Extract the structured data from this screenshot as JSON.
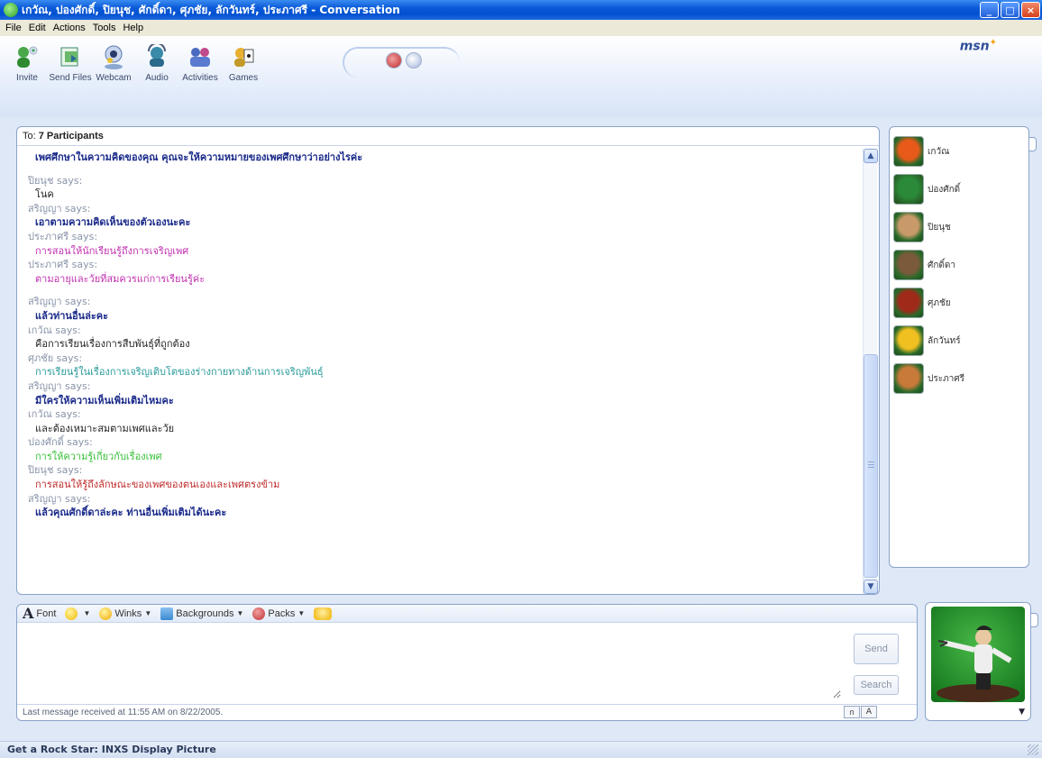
{
  "window": {
    "title": "เกวัณ, ปองศักดิ์, ปิยนุช, ศักดิ์ดา, ศุภชัย, ลักวันทร์, ประภาศรี - Conversation",
    "minimize": "_",
    "maximize": "□",
    "close": "×"
  },
  "menu": [
    "File",
    "Edit",
    "Actions",
    "Tools",
    "Help"
  ],
  "toolbar": {
    "items": [
      {
        "label": "Invite",
        "icon": "invite-icon",
        "color": "#3a9a3a"
      },
      {
        "label": "Send Files",
        "icon": "send-files-icon",
        "color": "#3a8a6a"
      },
      {
        "label": "Webcam",
        "icon": "webcam-icon",
        "color": "#5a78b0"
      },
      {
        "label": "Audio",
        "icon": "audio-icon",
        "color": "#3a7a9a"
      },
      {
        "label": "Activities",
        "icon": "activities-icon",
        "color": "#4a6ac0"
      },
      {
        "label": "Games",
        "icon": "games-icon",
        "color": "#c49a28"
      }
    ],
    "msn_logo": "msn",
    "msn_butterfly": "✦"
  },
  "chat": {
    "to_label": "To:",
    "to_value": "7 Participants",
    "lines": [
      {
        "kind": "msg",
        "text": "เพศศึกษาในความคิดของคุณ  คุณจะให้ความหมายของเพศศึกษาว่าอย่างไรค่ะ",
        "color": "#1a2a8a",
        "bold": true
      },
      {
        "kind": "spacer",
        "text": ""
      },
      {
        "kind": "says",
        "text": "ปิยนุช says:"
      },
      {
        "kind": "msg",
        "text": "โนค",
        "color": "#222222",
        "bold": false
      },
      {
        "kind": "says",
        "text": "สริญญา says:"
      },
      {
        "kind": "msg",
        "text": "เอาตามความคิดเห็นของตัวเองนะคะ",
        "color": "#1a2a8a",
        "bold": true
      },
      {
        "kind": "says",
        "text": "ประภาศรี says:"
      },
      {
        "kind": "msg",
        "text": "การสอนให้นักเรียนรู้ถึงการเจริญเพศ",
        "color": "#c030b0",
        "bold": false
      },
      {
        "kind": "says",
        "text": "ประภาศรี says:"
      },
      {
        "kind": "msg",
        "text": "ตามอายุและวัยที่สมควรแก่การเรียนรู้ค่ะ",
        "color": "#c030b0",
        "bold": false
      },
      {
        "kind": "spacer",
        "text": ""
      },
      {
        "kind": "says",
        "text": "สริญญา says:"
      },
      {
        "kind": "msg",
        "text": "แล้วท่านอื่นล่ะคะ",
        "color": "#1a2a8a",
        "bold": true
      },
      {
        "kind": "says",
        "text": "เกวัณ says:"
      },
      {
        "kind": "msg",
        "text": "คือการเรียนเรื่องการสืบพันธุ์ที่ถูกต้อง",
        "color": "#222222",
        "bold": false
      },
      {
        "kind": "says",
        "text": "ศุภชัย says:"
      },
      {
        "kind": "msg",
        "text": "การเรียนรู้ในเรื่องการเจริญเติบโตของร่างกายทางด้านการเจริญพันธุ์",
        "color": "#2a9a9a",
        "bold": false
      },
      {
        "kind": "says",
        "text": "สริญญา says:"
      },
      {
        "kind": "msg",
        "text": "มีใครให้ความเห็นเพิ่มเติมไหมคะ",
        "color": "#1a2a8a",
        "bold": true
      },
      {
        "kind": "says",
        "text": "เกวัณ says:"
      },
      {
        "kind": "msg",
        "text": "และต้องเหมาะสมตามเพศและวัย",
        "color": "#222222",
        "bold": false
      },
      {
        "kind": "says",
        "text": "ปองศักดิ์ says:"
      },
      {
        "kind": "msg",
        "text": "การให้ความรู้เกี่ยวกับเรื่องเพศ",
        "color": "#3ac03a",
        "bold": false
      },
      {
        "kind": "says",
        "text": "ปิยนุช says:"
      },
      {
        "kind": "msg",
        "text": "การสอนให้รู้ถึงลักษณะของเพศของตนเองและเพศตรงข้าม",
        "color": "#c02a2a",
        "bold": false
      },
      {
        "kind": "says",
        "text": "สริญญา says:"
      },
      {
        "kind": "msg",
        "text": "แล้วคุณศักดิ์ดาล่ะคะ  ท่านอื่นเพิ่มเติมได้นะคะ",
        "color": "#1a2a8a",
        "bold": true
      }
    ]
  },
  "participants": [
    {
      "name": "เกวัณ",
      "avatar": "flower-avatar",
      "color": "#e85a1a"
    },
    {
      "name": "ปองศักดิ์",
      "avatar": "soccer-ball-avatar",
      "color": "#2a8a3a"
    },
    {
      "name": "ปิยนุช",
      "avatar": "dog-avatar",
      "color": "#c89a6a"
    },
    {
      "name": "ศักดิ์ดา",
      "avatar": "chess-avatar",
      "color": "#7a5a3a"
    },
    {
      "name": "ศุภชัย",
      "avatar": "guitar-avatar",
      "color": "#a02a1a"
    },
    {
      "name": "ลักวันทร์",
      "avatar": "duck-avatar",
      "color": "#f0c020"
    },
    {
      "name": "ประภาศรี",
      "avatar": "monkey-avatar",
      "color": "#c87a3a"
    }
  ],
  "format_bar": {
    "font": "Font",
    "font_glyph": "A",
    "emoticon_glyph": "☺",
    "winks": "Winks",
    "backgrounds": "Backgrounds",
    "packs": "Packs",
    "dropdown_glyph": "▼"
  },
  "input": {
    "value": "",
    "send": "Send",
    "search": "Search",
    "status": "Last message received at 11:55 AM on 8/22/2005.",
    "ime_a": "A",
    "ime_b": "ก"
  },
  "ad_text": "Get a Rock Star: INXS Display Picture"
}
